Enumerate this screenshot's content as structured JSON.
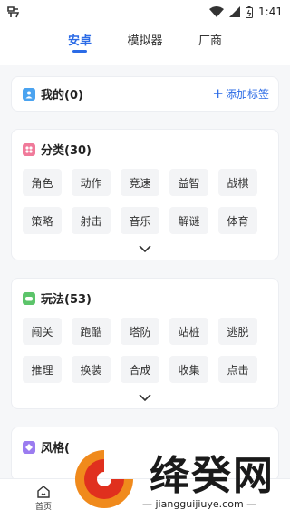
{
  "status_bar": {
    "time": "1:41"
  },
  "tabs": [
    {
      "label": "安卓",
      "active": true
    },
    {
      "label": "模拟器",
      "active": false
    },
    {
      "label": "厂商",
      "active": false
    }
  ],
  "mine": {
    "title": "我的(0)",
    "add_label": "添加标签"
  },
  "categories": {
    "title": "分类(30)",
    "chips": [
      "角色",
      "动作",
      "竞速",
      "益智",
      "战棋",
      "策略",
      "射击",
      "音乐",
      "解谜",
      "体育"
    ]
  },
  "gameplay": {
    "title": "玩法(53)",
    "chips": [
      "闯关",
      "跑酷",
      "塔防",
      "站桩",
      "逃脱",
      "推理",
      "换装",
      "合成",
      "收集",
      "点击"
    ]
  },
  "style": {
    "title": "风格("
  },
  "bottom_nav": {
    "home_label": "首页"
  },
  "watermark": {
    "text": "绛癸网",
    "url": "jiangguijiuye.com"
  },
  "colors": {
    "accent": "#2b6be6",
    "chip_bg": "#f3f4f6",
    "page_bg": "#f6f7f9"
  }
}
